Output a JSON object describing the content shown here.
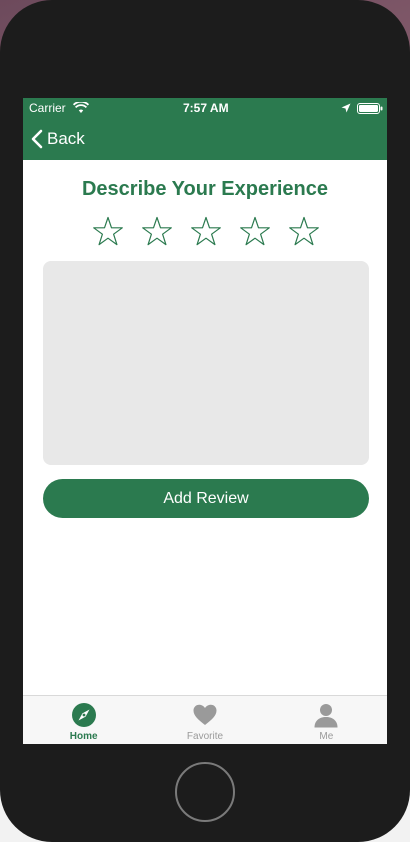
{
  "status_bar": {
    "carrier": "Carrier",
    "time": "7:57 AM"
  },
  "nav": {
    "back_label": "Back"
  },
  "main": {
    "heading": "Describe Your Experience",
    "rating": {
      "selected": 0,
      "max": 5
    },
    "review_input": {
      "value": "",
      "placeholder": ""
    },
    "submit_label": "Add Review"
  },
  "tabs": [
    {
      "label": "Home",
      "icon": "compass-icon",
      "active": true
    },
    {
      "label": "Favorite",
      "icon": "heart-icon",
      "active": false
    },
    {
      "label": "Me",
      "icon": "user-icon",
      "active": false
    }
  ],
  "colors": {
    "primary": "#2b7a4f",
    "inactive": "#9a9a9a",
    "input_background": "#e8e8e8"
  }
}
